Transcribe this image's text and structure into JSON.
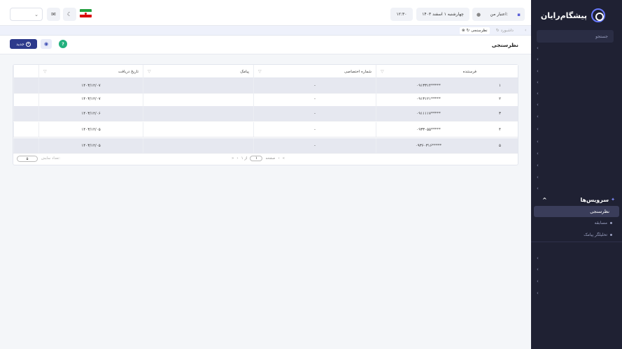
{
  "brand": {
    "name": "پیشگام‌رایان"
  },
  "sidebar": {
    "search_placeholder": "جستجو",
    "collapsed_rows": 14,
    "services_label": "سرویس‌ها",
    "sub_items": [
      {
        "label": "نظرسنجی",
        "active": true
      },
      {
        "label": "مسابقه",
        "active": false
      },
      {
        "label": "تحلیلگر پیامک",
        "active": false
      }
    ]
  },
  "topbar": {
    "credit_label": "اعتبار من:",
    "date": "چهارشنبه ۱ اسفند ۱۴۰۳",
    "time": "۱۲:۳۰"
  },
  "breadcrumb": {
    "home": "داشبورد",
    "current": "نظرسنجی"
  },
  "page": {
    "title": "نظرسنجی",
    "new_button": "جدید"
  },
  "table": {
    "headers": {
      "sender": "فرستنده",
      "private_number": "شماره اختصاصی",
      "sms": "پیامک",
      "received_date": "تاریخ دریافت"
    },
    "rows": [
      {
        "num": "۱",
        "sender": "۰۹۱۳۳۱۴*****",
        "private_number": "-",
        "sms": "",
        "date": "۱۴۰۳/۱۲/۰۷"
      },
      {
        "num": "۲",
        "sender": "۰۹۱۳۱۲۱*****",
        "private_number": "-",
        "sms": "",
        "date": "۱۴۰۳/۱۲/۰۷"
      },
      {
        "num": "۳",
        "sender": "۰۹۱۱۱۱۷*****",
        "private_number": "-",
        "sms": "",
        "date": "۱۴۰۳/۱۲/۰۶"
      },
      {
        "num": "۴",
        "sender": "۰۹۳۳۰۵۵*****",
        "private_number": "-",
        "sms": "",
        "date": "۱۴۰۳/۱۲/۰۵"
      },
      {
        "num": "۵",
        "sender": "۰۹۳۶۰۳۱۶*****",
        "private_number": "-",
        "sms": "",
        "date": "۱۴۰۳/۱۲/۰۵"
      }
    ],
    "pager": {
      "page_label": "صفحه",
      "current_page": "۱",
      "of_label": "از ۱",
      "page_size": "۵",
      "page_size_label": "تعداد نمایش:"
    }
  },
  "colors": {
    "sidebar_bg": "#1f2133",
    "accent": "#2d3a8c",
    "row_alt": "#e6e8f0"
  }
}
